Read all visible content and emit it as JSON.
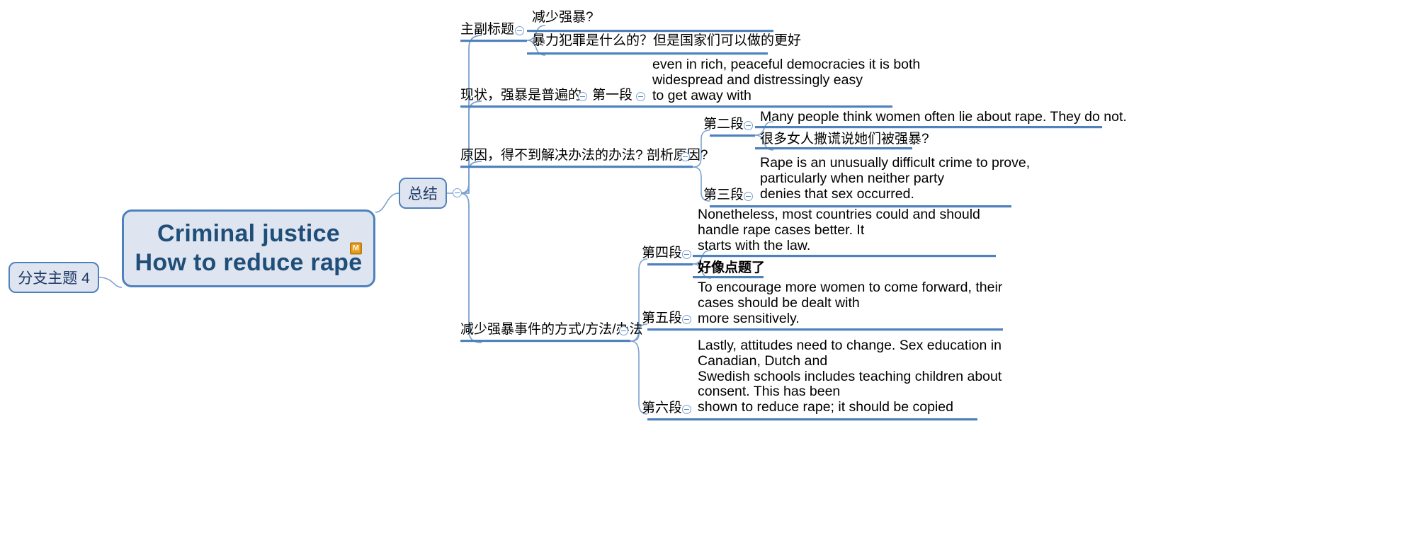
{
  "app": {
    "type": "mind-map",
    "accent_color": "#4f81bd",
    "node_fill": "#dee5f1",
    "node_border": "#4f81bd",
    "text_color": "#000000",
    "title_color": "#1f4e79",
    "marker_color": "#e8a020"
  },
  "central": {
    "line1": "Criminal justice",
    "line2": "How to reduce rape",
    "marker_icon": "M"
  },
  "left_branch": {
    "label": "分支主题 4"
  },
  "summary": {
    "label": "总结"
  },
  "branches": [
    {
      "label": "主副标题",
      "children": [
        {
          "label": "减少强暴?",
          "lang": "cn",
          "bold": false
        },
        {
          "label": "暴力犯罪是什么的？但是国家们可以做的更好",
          "lang": "cn",
          "bold": false
        }
      ]
    },
    {
      "label": "现状，强暴是普遍的",
      "sub_label": "第一段",
      "children": [
        {
          "label": "even in rich, peaceful democracies it is both\nwidespread and distressingly easy\nto get away with",
          "lang": "en",
          "bold": false
        }
      ]
    },
    {
      "label": "原因，得不到解决办法的办法? 剖析原因?",
      "groups": [
        {
          "label": "第二段",
          "children": [
            {
              "label": "Many people think women often lie about rape. They do not.",
              "lang": "en",
              "bold": false
            },
            {
              "label": "很多女人撒谎说她们被强暴?",
              "lang": "cn",
              "bold": false
            }
          ]
        },
        {
          "label": "第三段",
          "children": [
            {
              "label": "Rape is an unusually difficult crime to prove,\nparticularly when neither party\ndenies that sex occurred.",
              "lang": "en",
              "bold": false
            }
          ]
        }
      ]
    },
    {
      "label": "减少强暴事件的方式/方法/办法",
      "groups": [
        {
          "label": "第四段",
          "children": [
            {
              "label": "Nonetheless, most countries could and should\nhandle rape cases better. It\nstarts with the law.",
              "lang": "en",
              "bold": false
            },
            {
              "label": "好像点题了",
              "lang": "cn",
              "bold": true
            }
          ]
        },
        {
          "label": "第五段",
          "children": [
            {
              "label": "To encourage more women to come forward, their\ncases should be dealt with\nmore sensitively.",
              "lang": "en",
              "bold": false
            }
          ]
        },
        {
          "label": "第六段",
          "children": [
            {
              "label": "Lastly, attitudes need to change. Sex education in\nCanadian, Dutch and\nSwedish schools includes teaching children about\nconsent. This has been\nshown to reduce rape; it should be copied",
              "lang": "en",
              "bold": false
            }
          ]
        }
      ]
    }
  ]
}
